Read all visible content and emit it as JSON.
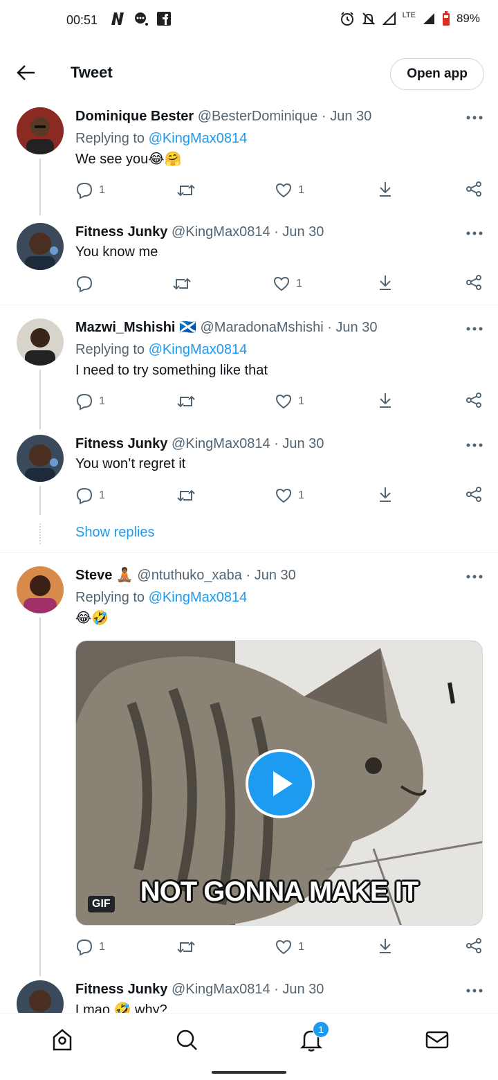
{
  "status_bar": {
    "time": "00:51",
    "battery": "89%",
    "network": "LTE"
  },
  "app_bar": {
    "title": "Tweet",
    "open_app": "Open app"
  },
  "tweets": [
    {
      "name": "Dominique Bester",
      "handle": "@BesterDominique",
      "date": "· Jun 30",
      "replying_prefix": "Replying to ",
      "replying_to": "@KingMax0814",
      "text": "We see you😂🤗",
      "replies": "1",
      "retweets": "",
      "likes": "1",
      "avatar_bg": "#7a1f1f"
    },
    {
      "name": "Fitness Junky",
      "handle": "@KingMax0814",
      "date": "· Jun 30",
      "text": "You know me",
      "replies": "",
      "retweets": "",
      "likes": "1",
      "avatar_bg": "#5a3a2a"
    },
    {
      "name": "Mazwi_Mshishi 🏴󠁧󠁢󠁳󠁣󠁴󠁿",
      "handle": "@MaradonaMshishi",
      "date": "· Jun 30",
      "replying_prefix": "Replying to ",
      "replying_to": "@KingMax0814",
      "text": "I need to try something like that",
      "replies": "1",
      "retweets": "",
      "likes": "1",
      "avatar_bg": "#3b3b3b"
    },
    {
      "name": "Fitness Junky",
      "handle": "@KingMax0814",
      "date": "· Jun 30",
      "text": "You won’t regret it",
      "replies": "1",
      "retweets": "",
      "likes": "1",
      "avatar_bg": "#5a3a2a"
    },
    {
      "name": "Steve 🧘🏾",
      "handle": "@ntuthuko_xaba",
      "date": "· Jun 30",
      "replying_prefix": "Replying to ",
      "replying_to": "@KingMax0814",
      "text": "😂🤣",
      "replies": "1",
      "retweets": "",
      "likes": "1",
      "avatar_bg": "#c0603a",
      "media": {
        "caption": "NOT GONNA MAKE IT",
        "badge": "GIF"
      }
    },
    {
      "name": "Fitness Junky",
      "handle": "@KingMax0814",
      "date": "· Jun 30",
      "text": "Lmao 🤣 why?",
      "avatar_bg": "#5a3a2a"
    }
  ],
  "show_replies": "Show replies",
  "bottom_nav": {
    "notifications_badge": "1"
  },
  "colors": {
    "accent": "#1d9bf0",
    "secondary_text": "#536471",
    "divider": "#eff3f4"
  }
}
